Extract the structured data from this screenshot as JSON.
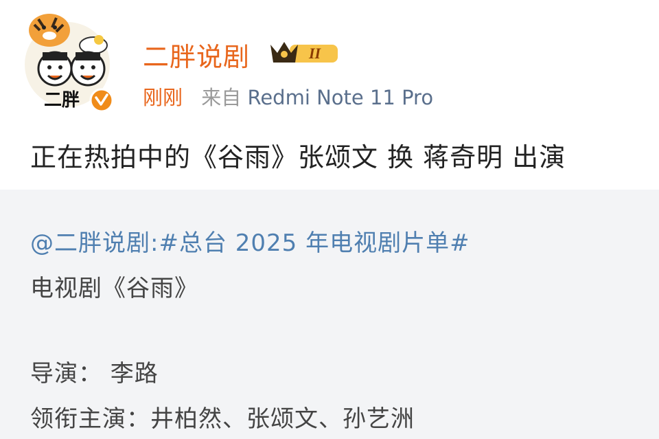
{
  "post": {
    "username": "二胖说剧",
    "vip_level": "II",
    "avatar_text": "二胖",
    "time": "刚刚",
    "source_prefix": "来自",
    "source_device": "Redmi Note 11 Pro",
    "content": "正在热拍中的《谷雨》张颂文 换 蒋奇明 出演"
  },
  "repost": {
    "mention_line": "@二胖说剧:#总台 2025 年电视剧片单#",
    "title_line": "电视剧《谷雨》",
    "director_line": "导演： 李路",
    "cast_line": "领衔主演：井柏然、张颂文、孙艺洲"
  },
  "colors": {
    "accent_orange": "#e8661c",
    "link_blue": "#4f7fb0",
    "repost_bg": "#f3f4f6"
  },
  "icons": [
    "tiger-avatar-icon",
    "verified-badge-icon",
    "vip-crown-icon"
  ]
}
